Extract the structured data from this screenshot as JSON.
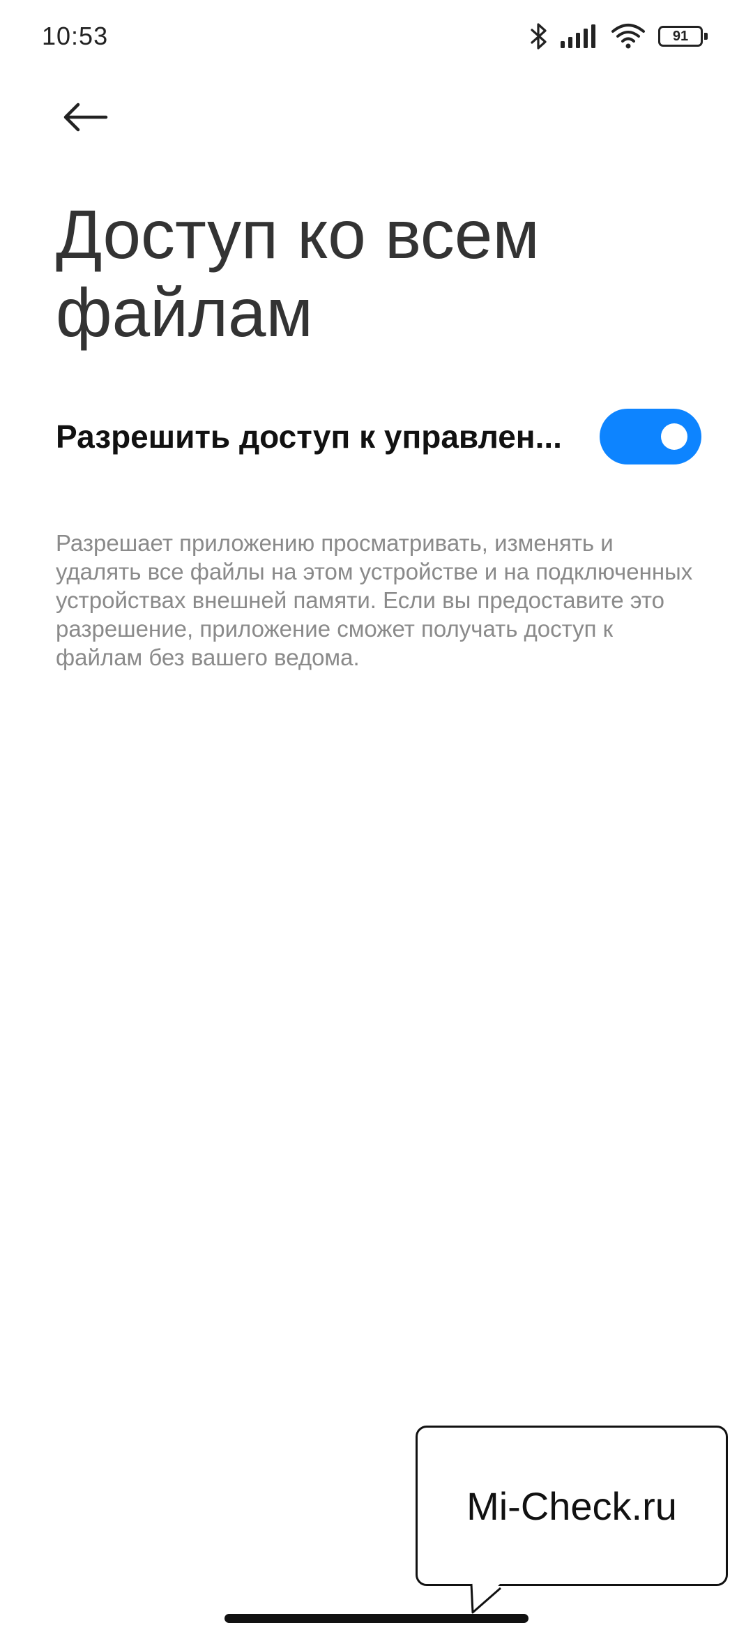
{
  "status_bar": {
    "time": "10:53",
    "battery_level": "91",
    "icons": [
      "bluetooth-icon",
      "signal-icon",
      "wifi-icon",
      "battery-icon"
    ]
  },
  "header": {
    "back_icon": "arrow-left-icon",
    "title": "Доступ ко всем файлам"
  },
  "setting": {
    "label": "Разрешить доступ к управлен...",
    "enabled": true,
    "description": "Разрешает приложению просматривать, изменять и удалять все файлы на этом устройстве и на подключенных устройствах внешней памяти. Если вы предоставите это разрешение, приложение сможет получать доступ к файлам без вашего ведома."
  },
  "watermark": {
    "text": "Mi-Check.ru"
  },
  "colors": {
    "accent": "#0d84ff",
    "title": "#333333",
    "description": "#8a8a8a",
    "background": "#ffffff"
  }
}
